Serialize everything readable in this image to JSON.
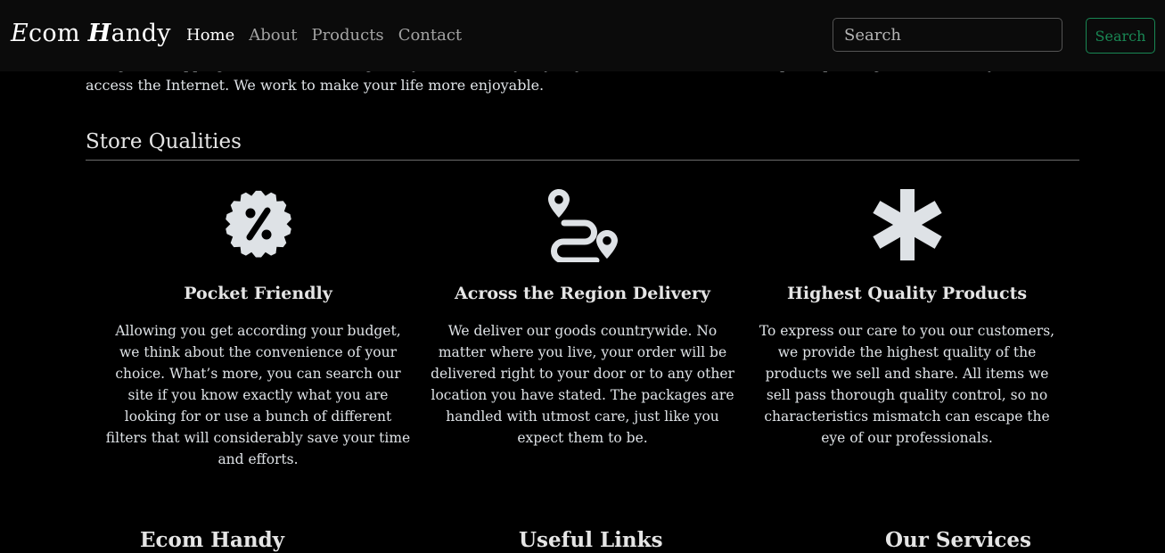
{
  "navbar": {
    "brand": {
      "letter1": "E",
      "part1": "com",
      "letter2": "H",
      "part2": "andy"
    },
    "links": [
      {
        "label": "Home"
      },
      {
        "label": "About"
      },
      {
        "label": "Products"
      },
      {
        "label": "Contact"
      }
    ],
    "active_link": "Home",
    "search": {
      "placeholder": "Search",
      "value": "",
      "button_label": "Search"
    }
  },
  "intro": {
    "text": "doing the shopping, etc. Purchase the goods you need every day or just like in a few clicks or taps, depending on the device you use to access the Internet. We work to make your life more enjoyable."
  },
  "qualities_section": {
    "title": "Store Qualities",
    "items": [
      {
        "icon": "discount-badge-icon",
        "title": "Pocket Friendly",
        "text": "Allowing you get according your budget, we think about the convenience of your choice. What’s more, you can search our site if you know exactly what you are looking for or use a bunch of different filters that will considerably save your time and efforts."
      },
      {
        "icon": "route-icon",
        "title": "Across the Region Delivery",
        "text": "We deliver our goods countrywide. No matter where you live, your order will be delivered right to your door or to any other location you have stated. The packages are handled with utmost care, just like you expect them to be."
      },
      {
        "icon": "asterisk-icon",
        "title": "Highest Quality Products",
        "text": "To express our care to you our customers, we provide the highest quality of the products we sell and share. All items we sell pass thorough quality control, so no characteristics mismatch can escape the eye of our professionals."
      }
    ]
  },
  "footer": {
    "headings": [
      "Ecom Handy",
      "Useful Links",
      "Our Services"
    ]
  },
  "colors": {
    "page_background": "#000000",
    "navbar_background": "#0b0b0b",
    "success_accent": "#198754",
    "text": "#dee2e6"
  }
}
